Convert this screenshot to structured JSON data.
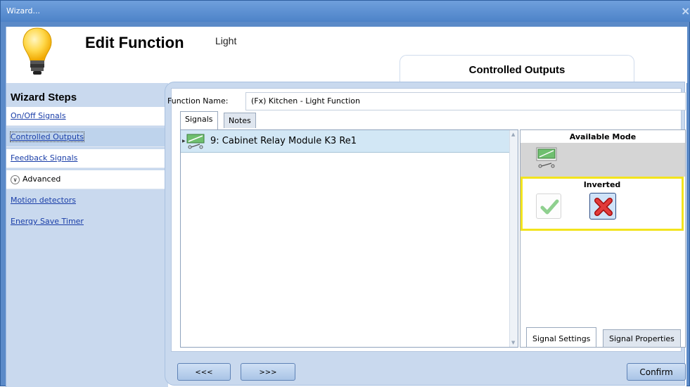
{
  "window": {
    "title": "Wizard...",
    "close": "×"
  },
  "header": {
    "title": "Edit Function",
    "subtitle": "Light",
    "tab_label": "Controlled Outputs"
  },
  "sidebar": {
    "title": "Wizard Steps",
    "items": [
      {
        "label": "On/Off Signals"
      },
      {
        "label": "Controlled Outputs"
      },
      {
        "label": "Feedback Signals"
      },
      {
        "label": "Advanced"
      },
      {
        "label": "Motion detectors"
      },
      {
        "label": "Energy Save Timer"
      }
    ]
  },
  "main": {
    "function_name_label": "Function Name:",
    "function_name_value": "(Fx) Kitchen - Light Function",
    "tabs": [
      {
        "label": "Signals"
      },
      {
        "label": "Notes"
      }
    ],
    "signals": [
      {
        "label": "9: Cabinet Relay Module K3 Re1"
      }
    ]
  },
  "right_panel": {
    "mode_header": "Available Mode",
    "inverted_label": "Inverted",
    "tabs": [
      {
        "label": "Signal Settings"
      },
      {
        "label": "Signal Properties"
      }
    ]
  },
  "buttons": {
    "back": "<<<",
    "next": ">>>",
    "confirm": "Confirm"
  },
  "colors": {
    "accent": "#5b8ac8",
    "highlight": "#f3e41d",
    "selected_row": "#d2e7f5"
  },
  "icons": [
    "light-bulb-icon",
    "relay-icon",
    "check-icon",
    "x-icon",
    "chevron-down-icon",
    "close-icon"
  ]
}
